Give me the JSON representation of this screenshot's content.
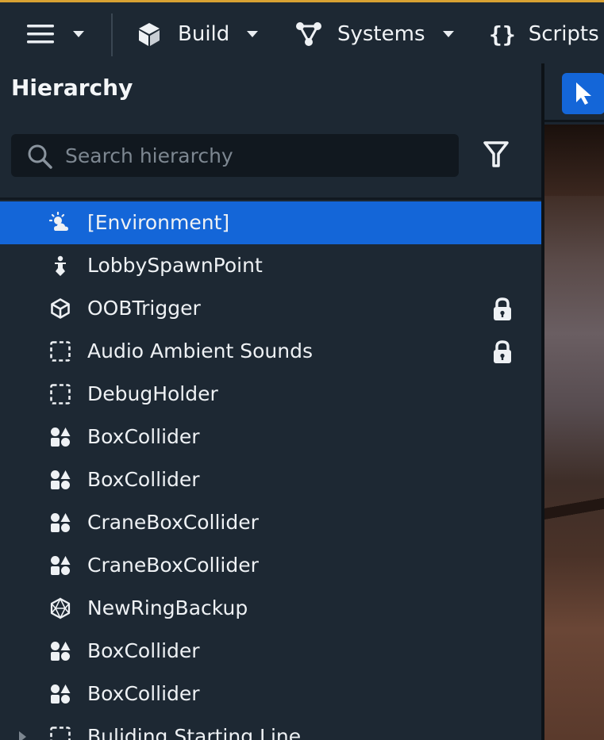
{
  "toolbar": {
    "menu_icon": "hamburger-menu-icon",
    "build_label": "Build",
    "systems_label": "Systems",
    "scripts_label": "Scripts"
  },
  "hierarchy": {
    "title": "Hierarchy",
    "search_placeholder": "Search hierarchy",
    "items": [
      {
        "label": "[Environment]",
        "icon": "environment-icon",
        "selected": true,
        "locked": false
      },
      {
        "label": "LobbySpawnPoint",
        "icon": "spawn-point-icon",
        "selected": false,
        "locked": false
      },
      {
        "label": "OOBTrigger",
        "icon": "trigger-cube-icon",
        "selected": false,
        "locked": true
      },
      {
        "label": "Audio Ambient Sounds",
        "icon": "empty-object-icon",
        "selected": false,
        "locked": true
      },
      {
        "label": "DebugHolder",
        "icon": "empty-object-icon",
        "selected": false,
        "locked": false
      },
      {
        "label": "BoxCollider",
        "icon": "shapes-icon",
        "selected": false,
        "locked": false
      },
      {
        "label": "BoxCollider",
        "icon": "shapes-icon",
        "selected": false,
        "locked": false
      },
      {
        "label": "CraneBoxCollider",
        "icon": "shapes-icon",
        "selected": false,
        "locked": false
      },
      {
        "label": "CraneBoxCollider",
        "icon": "shapes-icon",
        "selected": false,
        "locked": false
      },
      {
        "label": "NewRingBackup",
        "icon": "mesh-icon",
        "selected": false,
        "locked": false
      },
      {
        "label": "BoxCollider",
        "icon": "shapes-icon",
        "selected": false,
        "locked": false
      },
      {
        "label": "BoxCollider",
        "icon": "shapes-icon",
        "selected": false,
        "locked": false
      },
      {
        "label": "Buliding Starting Line",
        "icon": "empty-object-icon",
        "selected": false,
        "locked": false
      }
    ]
  },
  "viewport": {
    "active_tool_icon": "select-cursor-icon"
  },
  "colors": {
    "accent": "#1466d8",
    "panel": "#1d2833",
    "toolbar_top_border": "#d8a233"
  }
}
